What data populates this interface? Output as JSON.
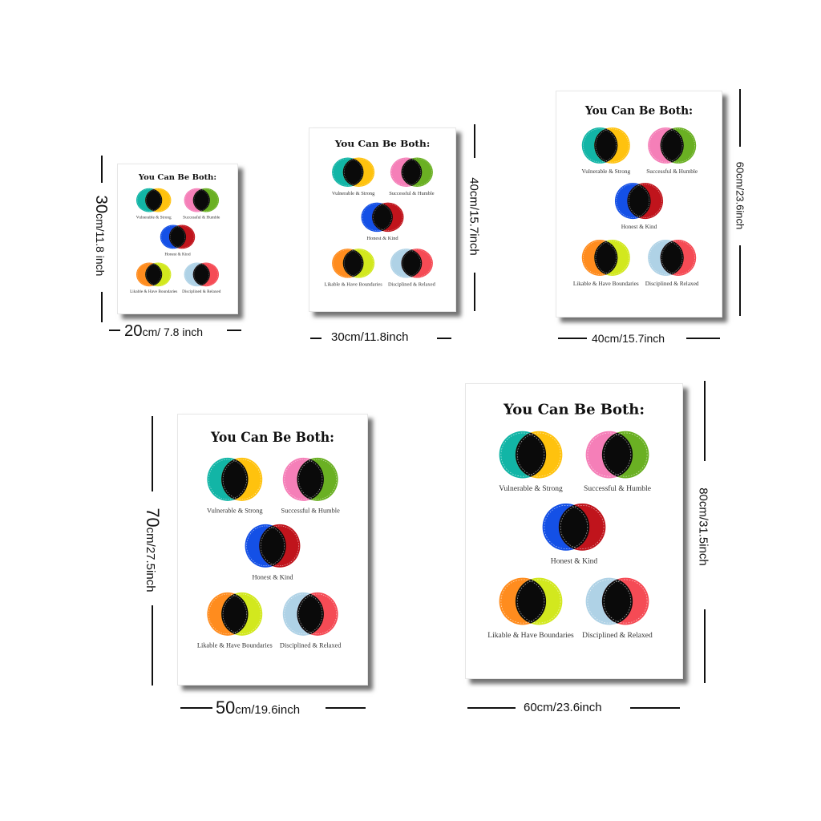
{
  "poster": {
    "title": "You Can Be Both:",
    "pairs": [
      {
        "label": "Vulnerable & Strong",
        "left_color": "#12b5a6",
        "right_color": "#ffc20e"
      },
      {
        "label": "Successful & Humble",
        "left_color": "#f57fb8",
        "right_color": "#6ab023"
      },
      {
        "label": "Honest & Kind",
        "left_color": "#1450e6",
        "right_color": "#c0141c"
      },
      {
        "label": "Likable & Have Boundaries",
        "left_color": "#ff8c1e",
        "right_color": "#d2e81e"
      },
      {
        "label": "Disciplined & Relaxed",
        "left_color": "#afd2e6",
        "right_color": "#f54b55"
      }
    ],
    "overlap_color": "#0a0a0a"
  },
  "sizes": [
    {
      "id": "s20x30",
      "width_num": "20",
      "width_unit": "cm/ 7.8 inch",
      "height_num": "30",
      "height_unit": "cm/11.8 inch"
    },
    {
      "id": "s30x40",
      "width_text": "30cm/11.8inch",
      "height_text": "40cm/15.7inch"
    },
    {
      "id": "s40x60",
      "width_text": "40cm/15.7inch",
      "height_text": "60cm/23.6inch"
    },
    {
      "id": "s50x70",
      "width_num": "50",
      "width_unit": "cm/19.6inch",
      "height_num": "70",
      "height_unit": "cm/27.5inch"
    },
    {
      "id": "s60x80",
      "width_text": "60cm/23.6inch",
      "height_text": "80cm/31.5inch"
    }
  ]
}
